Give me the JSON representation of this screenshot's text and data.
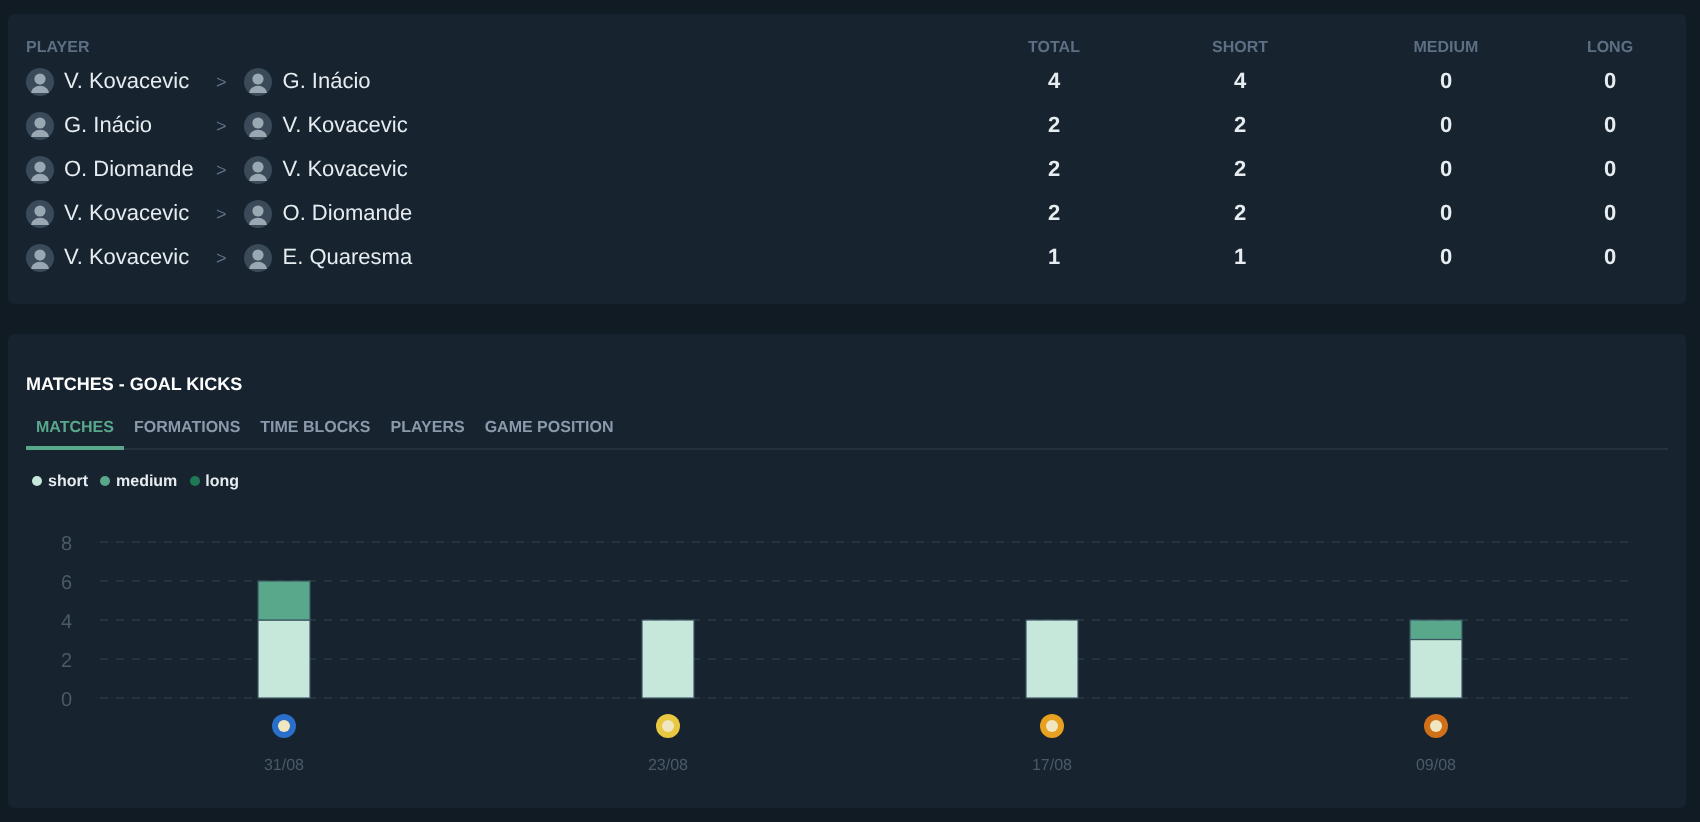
{
  "passes": {
    "columns": [
      "PLAYER",
      "TOTAL",
      "SHORT",
      "MEDIUM",
      "LONG"
    ],
    "rows": [
      {
        "from": "V. Kovacevic",
        "to": "G. Inácio",
        "separator": ">",
        "total": "4",
        "short": "4",
        "medium": "0",
        "long": "0"
      },
      {
        "from": "G. Inácio",
        "to": "V. Kovacevic",
        "separator": ">",
        "total": "2",
        "short": "2",
        "medium": "0",
        "long": "0"
      },
      {
        "from": "O. Diomande",
        "to": "V. Kovacevic",
        "separator": ">",
        "total": "2",
        "short": "2",
        "medium": "0",
        "long": "0"
      },
      {
        "from": "V. Kovacevic",
        "to": "O. Diomande",
        "separator": ">",
        "total": "2",
        "short": "2",
        "medium": "0",
        "long": "0"
      },
      {
        "from": "V. Kovacevic",
        "to": "E. Quaresma",
        "separator": ">",
        "total": "1",
        "short": "1",
        "medium": "0",
        "long": "0"
      }
    ]
  },
  "goal_kicks": {
    "title": "MATCHES - GOAL KICKS",
    "tabs": [
      {
        "label": "MATCHES",
        "selected": true
      },
      {
        "label": "FORMATIONS",
        "selected": false
      },
      {
        "label": "TIME BLOCKS",
        "selected": false
      },
      {
        "label": "PLAYERS",
        "selected": false
      },
      {
        "label": "GAME POSITION",
        "selected": false
      }
    ],
    "matches": [
      {
        "color": "#2a6fc9"
      },
      {
        "color": "#e8c840"
      },
      {
        "color": "#e8a020"
      },
      {
        "color": "#d07018"
      }
    ],
    "chart_data": {
      "type": "bar",
      "stacked": true,
      "categories": [
        "31/08",
        "23/08",
        "17/08",
        "09/08"
      ],
      "series": [
        {
          "name": "short",
          "color": "#c5e8db",
          "values": [
            4,
            4,
            4,
            3
          ]
        },
        {
          "name": "medium",
          "color": "#5aa88c",
          "values": [
            2,
            0,
            0,
            1
          ]
        },
        {
          "name": "long",
          "color": "#1e7a55",
          "values": [
            0,
            0,
            0,
            0
          ]
        }
      ],
      "ylim": [
        0,
        8
      ],
      "yticks": [
        0,
        2,
        4,
        6,
        8
      ],
      "grid": true,
      "legend": true
    }
  }
}
